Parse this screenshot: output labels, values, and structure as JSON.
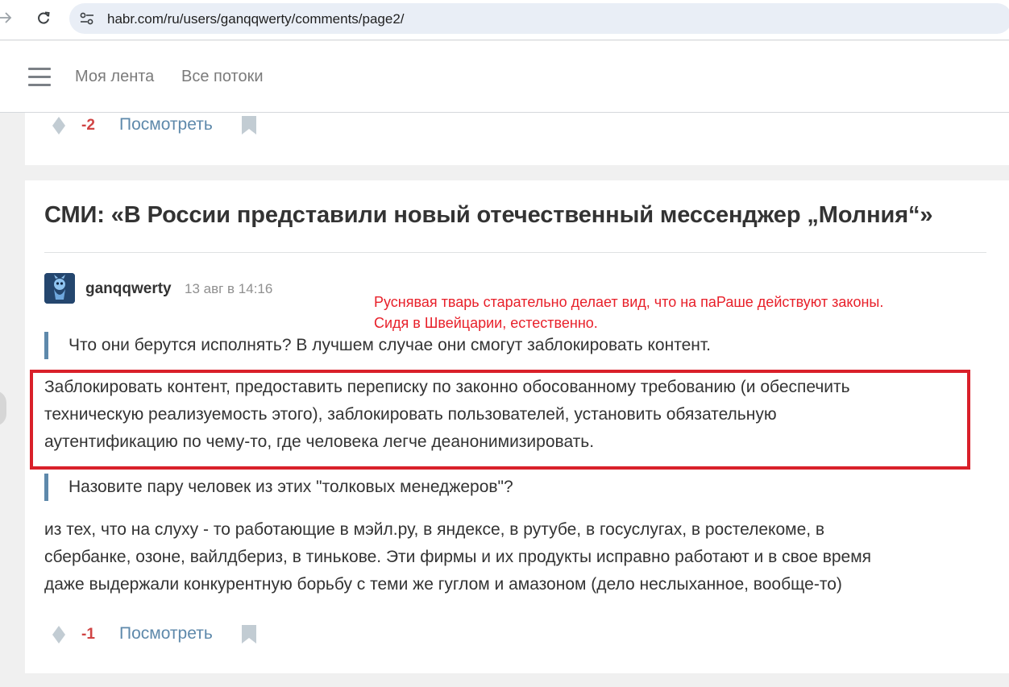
{
  "browser": {
    "url": "habr.com/ru/users/ganqqwerty/comments/page2/"
  },
  "header": {
    "nav": [
      "Моя лента",
      "Все потоки"
    ]
  },
  "previous_comment": {
    "score": "-2",
    "view_label": "Посмотреть"
  },
  "comment": {
    "article_title": "СМИ: «В России представили новый отечественный мессенджер „Молния“»",
    "author": "ganqqwerty",
    "timestamp": "13 авг в 14:16",
    "quote1": "Что они берутся исполнять? В лучшем случае они смогут заблокировать контент.",
    "paragraph1_lines": [
      "Заблокировать контент, предоставить переписку по законно обосованному требованию (и обеспечить",
      "техническую реализуемость этого), заблокировать пользователей, установить обязательную",
      "аутентификацию по чему-то, где человека легче деанонимизировать."
    ],
    "quote2": "Назовите пару человек из этих \"толковых менеджеров\"?",
    "paragraph2_lines": [
      "из тех, что на слуху - то работающие в мэйл.ру, в яндексе, в рутубе, в госуслугах, в ростелекоме, в",
      "сбербанке, озоне, вайлдбериз, в тинькове. Эти фирмы и их продукты исправно работают и в свое время",
      "даже выдержали конкурентную борьбу с теми же гуглом и амазоном (дело неслыханное, вообще-то)"
    ],
    "score": "-1",
    "view_label": "Посмотреть"
  },
  "annotation": {
    "lines": [
      "Руснявая тварь старательно делает вид, что на паРаше действуют законы.",
      "Сидя в Швейцарии, естественно."
    ]
  },
  "colors": {
    "negative_score": "#d04444",
    "link": "#5e89ab",
    "annotation": "#e8202a",
    "highlight_border": "#d9202a"
  },
  "icons": [
    "back-arrow-icon",
    "reload-icon",
    "site-settings-icon",
    "menu-icon",
    "vote-icon",
    "bookmark-icon",
    "avatar"
  ]
}
